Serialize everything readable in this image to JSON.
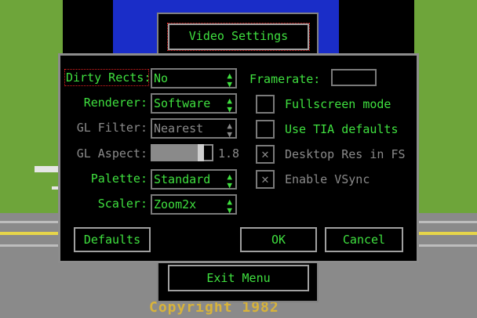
{
  "menu": {
    "video_settings": "Video Settings",
    "exit_menu": "Exit Menu"
  },
  "backdrop": {
    "copyright": "Copyright 1982"
  },
  "dialog": {
    "fields": {
      "dirty_rects": {
        "label": "Dirty Rects:",
        "value": "No"
      },
      "renderer": {
        "label": "Renderer:",
        "value": "Software"
      },
      "gl_filter": {
        "label": "GL Filter:",
        "value": "Nearest"
      },
      "gl_aspect": {
        "label": "GL Aspect:",
        "value": "1.8",
        "level": 0.85
      },
      "palette": {
        "label": "Palette:",
        "value": "Standard"
      },
      "scaler": {
        "label": "Scaler:",
        "value": "Zoom2x"
      },
      "framerate": {
        "label": "Framerate:",
        "value": ""
      }
    },
    "checkboxes": {
      "fullscreen": {
        "label": "Fullscreen mode",
        "checked": false
      },
      "tia_defaults": {
        "label": "Use TIA defaults",
        "checked": false
      },
      "desktop_res": {
        "label": "Desktop Res in FS",
        "checked": true
      },
      "vsync": {
        "label": "Enable VSync",
        "checked": true
      }
    },
    "check_mark": "✕",
    "arrow_up": "▲",
    "arrow_down": "▼",
    "buttons": {
      "defaults": "Defaults",
      "ok": "OK",
      "cancel": "Cancel"
    }
  },
  "colors": {
    "accent_text": "#3fe03f",
    "disabled_text": "#8a8a8a",
    "focus_outline": "#e02020"
  }
}
